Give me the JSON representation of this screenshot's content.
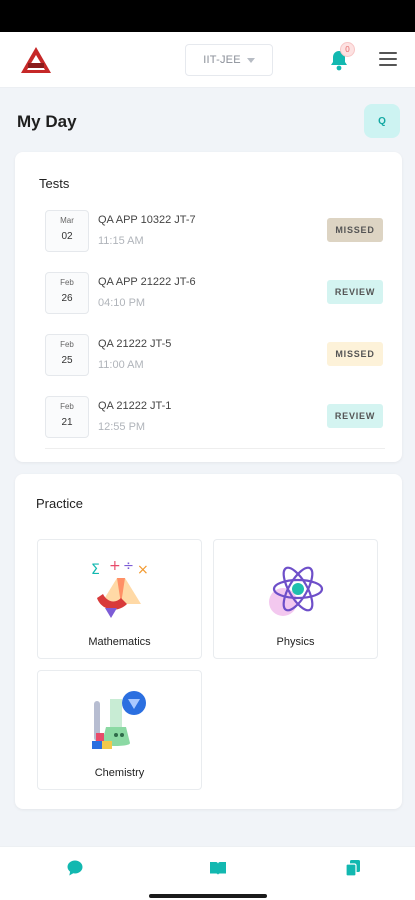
{
  "header": {
    "exam_select": "IIT-JEE",
    "notification_count": "0"
  },
  "page": {
    "title": "My Day",
    "search_label": "Q"
  },
  "tests": {
    "title": "Tests",
    "items": [
      {
        "month": "Mar",
        "day": "02",
        "name": "QA APP 10322 JT-7",
        "time": "11:15 AM",
        "status": "MISSED"
      },
      {
        "month": "Feb",
        "day": "26",
        "name": "QA APP 21222 JT-6",
        "time": "04:10 PM",
        "status": "REVIEW"
      },
      {
        "month": "Feb",
        "day": "25",
        "name": "QA 21222 JT-5",
        "time": "11:00 AM",
        "status": "MISSED"
      },
      {
        "month": "Feb",
        "day": "21",
        "name": "QA 21222 JT-1",
        "time": "12:55 PM",
        "status": "REVIEW"
      }
    ]
  },
  "practice": {
    "title": "Practice",
    "subjects": [
      {
        "name": "Mathematics",
        "icon": "math-icon"
      },
      {
        "name": "Physics",
        "icon": "atom-icon"
      },
      {
        "name": "Chemistry",
        "icon": "flask-icon"
      }
    ]
  },
  "colors": {
    "accent": "#12b8b0",
    "missed_dark": "#ddd4c3",
    "missed_light": "#fdf2d9",
    "review": "#d4f4f1"
  }
}
